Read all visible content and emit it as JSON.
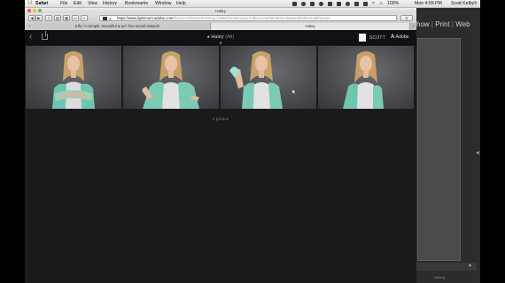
{
  "menubar": {
    "apple": "",
    "items": [
      "Safari",
      "File",
      "Edit",
      "View",
      "History",
      "Bookmarks",
      "Window",
      "Help"
    ],
    "battery": "100%",
    "clock": "Mon 4:59 PM",
    "user": "Scott Kelby"
  },
  "window": {
    "title": "Haley"
  },
  "toolbar": {
    "back": "◀",
    "forward": "▶",
    "domain": "https://www.lightroom.adobe.com",
    "path": "/libraries/20e05c8e0254431589fc4ca810aae7/albums/a6f8836f6a1385a6d5f09bc03d6fa13e5"
  },
  "tabs": [
    {
      "label": "Elfo / A Simple, Beautiful & ad- free social network"
    },
    {
      "label": "Haley"
    }
  ],
  "app": {
    "album_name": "Haley",
    "album_filter": "(All)",
    "user_name": "SCOTT",
    "brand": "Adobe",
    "photo_count": "4 photos",
    "photos": [
      {
        "pose": "arms-crossed"
      },
      {
        "pose": "hand-on-hip"
      },
      {
        "pose": "hand-raised"
      },
      {
        "pose": "scarf-draped"
      }
    ]
  },
  "background_app": {
    "modules": [
      "how",
      "Print",
      "Web"
    ],
    "footer": "sticking"
  }
}
